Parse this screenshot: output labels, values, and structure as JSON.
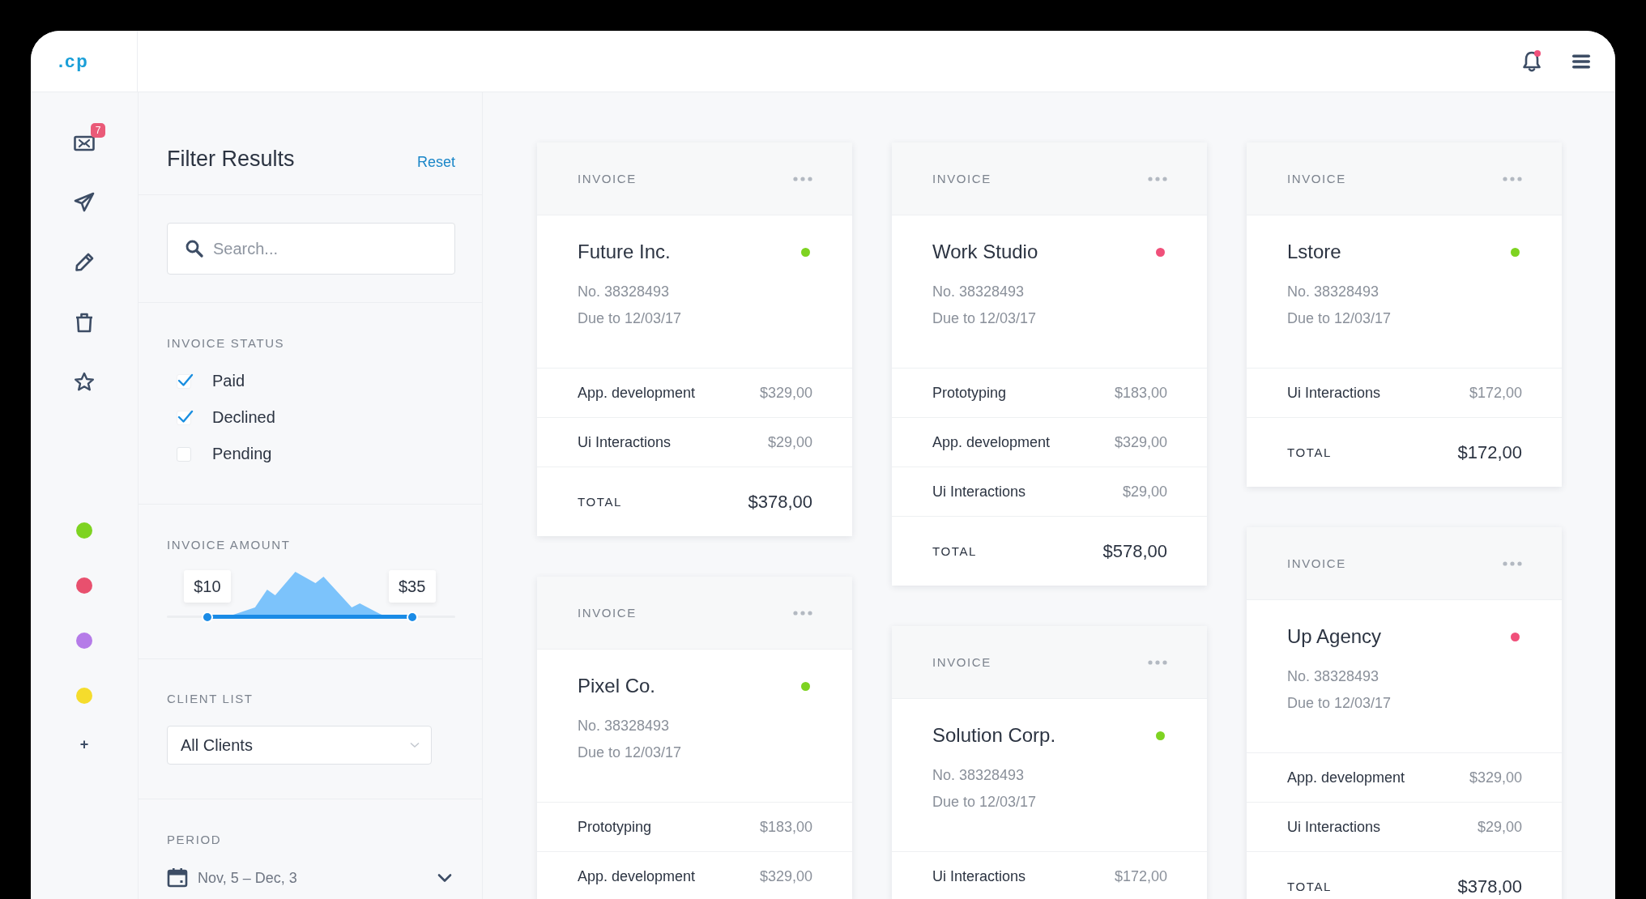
{
  "logo": ".cp",
  "header": {
    "notification": true
  },
  "rail": {
    "mail_badge": "7",
    "tags": [
      {
        "color": "#7ed321"
      },
      {
        "color": "#e8506e"
      },
      {
        "color": "#b57be8"
      },
      {
        "color": "#f5dc2c"
      }
    ],
    "add": "+"
  },
  "filter": {
    "title": "Filter Results",
    "reset": "Reset",
    "search": {
      "placeholder": "Search..."
    },
    "status": {
      "label": "INVOICE STATUS",
      "options": [
        {
          "label": "Paid",
          "checked": true
        },
        {
          "label": "Declined",
          "checked": true
        },
        {
          "label": "Pending",
          "checked": false
        }
      ]
    },
    "amount": {
      "label": "INVOICE AMOUNT",
      "low": {
        "label": "$10",
        "level": 0.14
      },
      "high": {
        "label": "$35",
        "level": 0.85
      }
    },
    "clients": {
      "label": "CLIENT LIST",
      "value": "All Clients"
    },
    "period": {
      "label": "PERIOD",
      "value": "Nov, 5 – Dec, 3"
    }
  },
  "columns": [
    [
      {
        "header": "INVOICE",
        "client": "Future Inc.",
        "color": "#7ed321",
        "number": "No. 38328493",
        "due": "Due to 12/03/17",
        "lines": [
          {
            "item": "App. development",
            "amount": "$329,00"
          },
          {
            "item": "Ui Interactions",
            "amount": "$29,00"
          }
        ],
        "total": {
          "label": "TOTAL",
          "amount": "$378,00"
        }
      },
      {
        "header": "INVOICE",
        "client": "Pixel Co.",
        "color": "#7ed321",
        "number": "No. 38328493",
        "due": "Due to 12/03/17",
        "lines": [
          {
            "item": "Prototyping",
            "amount": "$183,00"
          },
          {
            "item": "App. development",
            "amount": "$329,00"
          }
        ]
      }
    ],
    [
      {
        "header": "INVOICE",
        "client": "Work Studio",
        "color": "#f0507a",
        "number": "No. 38328493",
        "due": "Due to 12/03/17",
        "lines": [
          {
            "item": "Prototyping",
            "amount": "$183,00"
          },
          {
            "item": "App. development",
            "amount": "$329,00"
          },
          {
            "item": "Ui Interactions",
            "amount": "$29,00"
          }
        ],
        "total": {
          "label": "TOTAL",
          "amount": "$578,00"
        }
      },
      {
        "header": "INVOICE",
        "client": "Solution Corp.",
        "color": "#7ed321",
        "number": "No. 38328493",
        "due": "Due to 12/03/17",
        "lines": [
          {
            "item": "Ui Interactions",
            "amount": "$172,00"
          }
        ]
      }
    ],
    [
      {
        "header": "INVOICE",
        "client": "Lstore",
        "color": "#7ed321",
        "number": "No. 38328493",
        "due": "Due to 12/03/17",
        "lines": [
          {
            "item": "Ui Interactions",
            "amount": "$172,00"
          }
        ],
        "total": {
          "label": "TOTAL",
          "amount": "$172,00"
        }
      },
      {
        "header": "INVOICE",
        "client": "Up Agency",
        "color": "#f0507a",
        "number": "No. 38328493",
        "due": "Due to 12/03/17",
        "lines": [
          {
            "item": "App. development",
            "amount": "$329,00"
          },
          {
            "item": "Ui Interactions",
            "amount": "$29,00"
          }
        ],
        "total": {
          "label": "TOTAL",
          "amount": "$378,00"
        }
      }
    ]
  ]
}
